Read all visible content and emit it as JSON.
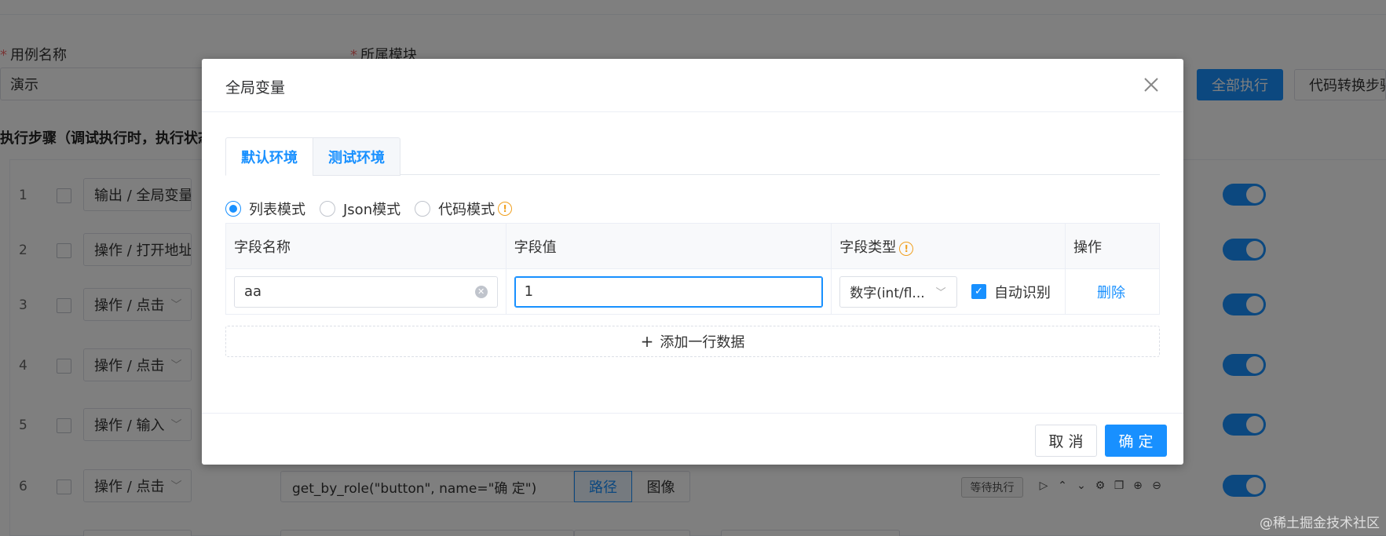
{
  "background": {
    "form": {
      "case_name_label": "用例名称",
      "case_name_value": "演示",
      "module_label": "所属模块",
      "required_mark": "*"
    },
    "toolbar": {
      "run_all_label": "全部执行",
      "convert_label": "代码转换步骤"
    },
    "steps_title": "执行步骤（调试执行时，执行状态",
    "steps": [
      {
        "num": "1",
        "action": "输出 / 全局变量"
      },
      {
        "num": "2",
        "action": "操作 / 打开地址"
      },
      {
        "num": "3",
        "action": "操作 / 点击"
      },
      {
        "num": "4",
        "action": "操作 / 点击"
      },
      {
        "num": "5",
        "action": "操作 / 输入"
      },
      {
        "num": "6",
        "action": "操作 / 点击"
      }
    ],
    "row6": {
      "locator": "get_by_role(\"button\", name=\"确 定\")",
      "path_label": "路径",
      "image_label": "图像",
      "status": "等待执行"
    },
    "op_icons": [
      "play-icon",
      "move-up-icon",
      "move-down-icon",
      "settings-icon",
      "copy-icon",
      "add-icon",
      "remove-icon"
    ],
    "watermark": "@稀土掘金技术社区"
  },
  "dialog": {
    "title": "全局变量",
    "tabs": [
      {
        "label": "默认环境",
        "active": true
      },
      {
        "label": "测试环境",
        "active": false
      }
    ],
    "modes": [
      {
        "label": "列表模式",
        "checked": true
      },
      {
        "label": "Json模式",
        "checked": false
      },
      {
        "label": "代码模式",
        "checked": false,
        "info_icon": "info-icon"
      }
    ],
    "table": {
      "headers": {
        "name": "字段名称",
        "value": "字段值",
        "type": "字段类型",
        "ops": "操作"
      },
      "rows": [
        {
          "name": "aa",
          "value": "1",
          "type": "数字(int/fl...",
          "auto_detect_label": "自动识别",
          "auto_detect_checked": true,
          "delete_label": "删除"
        }
      ]
    },
    "add_row_label": "添加一行数据",
    "cancel_label": "取 消",
    "confirm_label": "确 定"
  },
  "colors": {
    "primary": "#1890ff",
    "warning": "#f0a020",
    "required": "#f56c6c"
  }
}
